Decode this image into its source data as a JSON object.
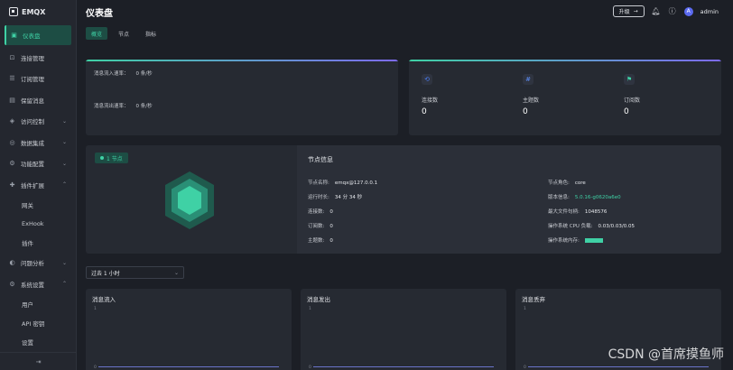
{
  "app": {
    "logo_text": "EMQX"
  },
  "sidebar": {
    "items": [
      {
        "label": "仪表盘",
        "icon": "dashboard-icon",
        "active": true
      },
      {
        "label": "连接管理",
        "icon": "connection-icon"
      },
      {
        "label": "订阅管理",
        "icon": "subscription-icon"
      },
      {
        "label": "保留消息",
        "icon": "retained-icon"
      },
      {
        "label": "访问控制",
        "icon": "shield-icon",
        "expandable": true
      },
      {
        "label": "数据集成",
        "icon": "integration-icon",
        "expandable": true
      },
      {
        "label": "功能配置",
        "icon": "settings-icon",
        "expandable": true
      },
      {
        "label": "插件扩展",
        "icon": "plugin-icon",
        "expandable": true,
        "expanded": true
      },
      {
        "label": "问题分析",
        "icon": "diagnose-icon",
        "expandable": true
      },
      {
        "label": "系统设置",
        "icon": "system-icon",
        "expandable": true,
        "expanded": true
      }
    ],
    "sub_plugin": [
      "网关",
      "ExHook",
      "插件"
    ],
    "sub_system": [
      "用户",
      "API 密钥",
      "设置"
    ],
    "collapse_icon": "collapse-icon"
  },
  "header": {
    "title": "仪表盘",
    "upgrade_label": "升级",
    "user": "admin",
    "avatar_letter": "A"
  },
  "tabs": [
    {
      "label": "概览",
      "active": true
    },
    {
      "label": "节点"
    },
    {
      "label": "指标"
    }
  ],
  "rates": {
    "in_label": "消息流入速率：",
    "in_value": "0 条/秒",
    "out_label": "消息流出速率：",
    "out_value": "0 条/秒"
  },
  "stats": [
    {
      "label": "连接数",
      "value": "0",
      "icon": "link-icon",
      "color": "#4a7cf0"
    },
    {
      "label": "主题数",
      "value": "0",
      "icon": "hash-icon",
      "color": "#5b8cf5"
    },
    {
      "label": "订阅数",
      "value": "0",
      "icon": "flag-icon",
      "color": "#3fd1a5"
    }
  ],
  "node": {
    "badge": "1 节点",
    "panel_title": "节点信息",
    "name_label": "节点名称:",
    "name_value": "emqx@127.0.0.1",
    "uptime_label": "运行时长:",
    "uptime_value": "34 分 34 秒",
    "conn_label": "连接数:",
    "conn_value": "0",
    "sub_label": "订阅数:",
    "sub_value": "0",
    "topic_label": "主题数:",
    "topic_value": "0",
    "role_label": "节点角色:",
    "role_value": "core",
    "version_label": "版本信息:",
    "version_value": "5.0.16-g0620a6e0",
    "maxfile_label": "最大文件句柄:",
    "maxfile_value": "1048576",
    "cpu_label": "操作系统 CPU 负载:",
    "cpu_value": "0.03/0.03/0.05",
    "mem_label": "操作系统内存:",
    "accent": "#3fd1a5"
  },
  "time_select": {
    "value": "过去 1 小时"
  },
  "charts": [
    {
      "title": "消息流入",
      "tick": "1",
      "base_tick": "0"
    },
    {
      "title": "消息发出",
      "tick": "1",
      "base_tick": "0"
    },
    {
      "title": "消息丢弃",
      "tick": "1",
      "base_tick": "0"
    }
  ],
  "watermark": "CSDN @首席摸鱼师"
}
